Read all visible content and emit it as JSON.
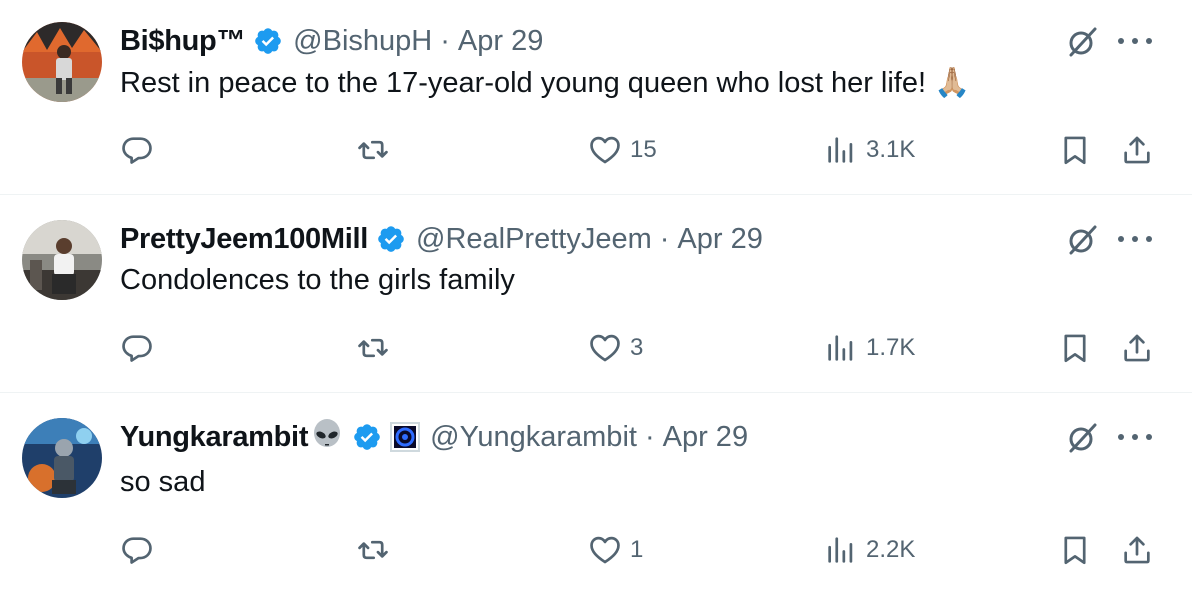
{
  "colors": {
    "text_primary": "#0f1419",
    "text_secondary": "#536471",
    "verified_blue": "#1d9bf0",
    "divider": "#eff3f4"
  },
  "tweets": [
    {
      "name": "Bi$hup™",
      "handle": "@BishupH",
      "separator": "·",
      "date": "Apr 29",
      "text": "Rest in peace to the 17-year-old young queen who lost her life! 🙏🏼",
      "replies": "",
      "retweets": "",
      "likes": "15",
      "views": "3.1K",
      "verified": true,
      "name_emoji": "",
      "affiliate_badge": false
    },
    {
      "name": "PrettyJeem100Mill",
      "handle": "@RealPrettyJeem",
      "separator": "·",
      "date": "Apr 29",
      "text": "Condolences to the girls family",
      "replies": "",
      "retweets": "",
      "likes": "3",
      "views": "1.7K",
      "verified": true,
      "name_emoji": "",
      "affiliate_badge": false
    },
    {
      "name": "Yungkarambit",
      "handle": "@Yungkarambit",
      "separator": "·",
      "date": "Apr 29",
      "text": "so sad",
      "replies": "",
      "retweets": "",
      "likes": "1",
      "views": "2.2K",
      "verified": true,
      "name_emoji": "👽",
      "affiliate_badge": true
    }
  ],
  "icons": {
    "verified": "verified-badge-icon",
    "grok": "grok-icon",
    "more": "more-icon",
    "reply": "reply-icon",
    "retweet": "retweet-icon",
    "like": "heart-icon",
    "views": "views-icon",
    "bookmark": "bookmark-icon",
    "share": "share-icon"
  }
}
